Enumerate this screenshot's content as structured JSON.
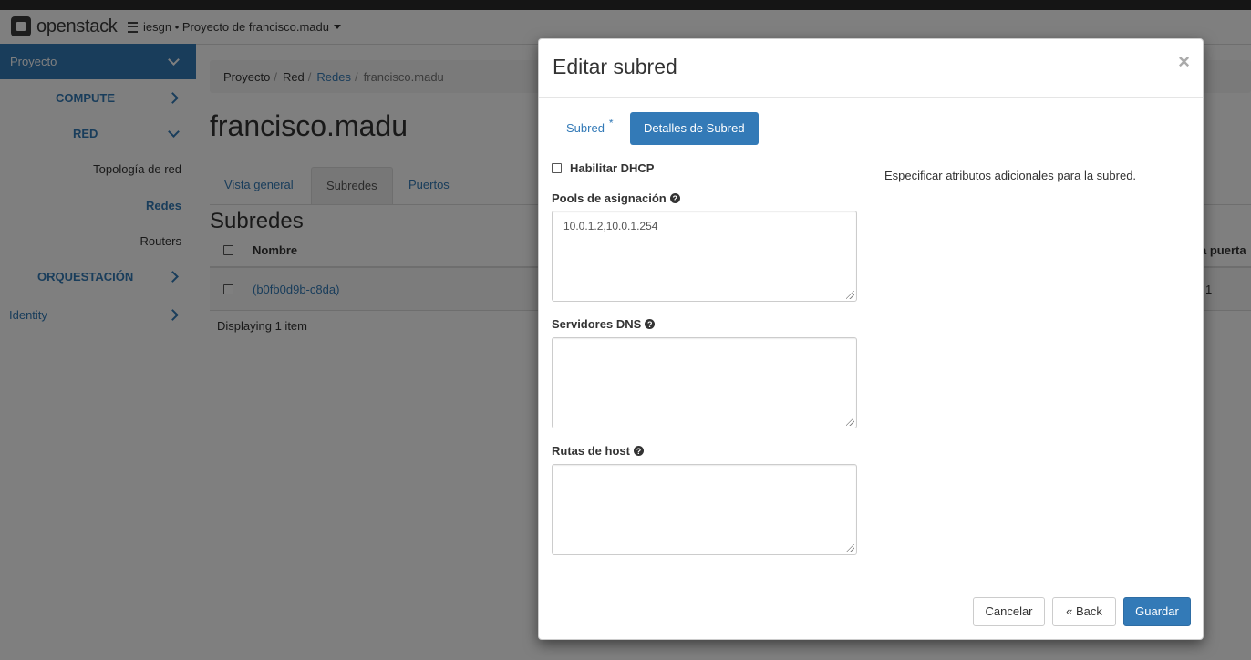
{
  "app": {
    "logo_text": "openstack"
  },
  "header": {
    "project_selector": "iesgn • Proyecto de francisco.madu"
  },
  "sidebar": {
    "top": "Proyecto",
    "compute": "COMPUTE",
    "red": "RED",
    "topologia": "Topología de red",
    "redes": "Redes",
    "routers": "Routers",
    "orquestacion": "ORQUESTACIÓN",
    "identity": "Identity"
  },
  "breadcrumb": {
    "items": [
      "Proyecto",
      "Red",
      "Redes",
      "francisco.madu"
    ]
  },
  "page": {
    "title": "francisco.madu",
    "tabs": [
      "Vista general",
      "Subredes",
      "Puertos"
    ],
    "section_title": "Subredes",
    "table": {
      "headers": [
        "Nombre",
        "a puerta"
      ],
      "rows": [
        {
          "name": "(b0fb0d9b-c8da)",
          "gateway_partial": "1"
        }
      ],
      "footer": "Displaying 1 item"
    }
  },
  "modal": {
    "title": "Editar subred",
    "close": "×",
    "tabs": {
      "subred": "Subred",
      "required_mark": "*",
      "detalles": "Detalles de Subred"
    },
    "dhcp_label": "Habilitar DHCP",
    "dhcp_checked": false,
    "pools_label": "Pools de asignación",
    "pools_value": "10.0.1.2,10.0.1.254",
    "dns_label": "Servidores DNS",
    "dns_value": "",
    "routes_label": "Rutas de host",
    "routes_value": "",
    "help_text": "Especificar atributos adicionales para la subred.",
    "buttons": {
      "cancel": "Cancelar",
      "back": "«  Back",
      "save": "Guardar"
    }
  },
  "colors": {
    "accent": "#337ab7",
    "backdrop": "rgba(0,0,0,0.5)"
  }
}
